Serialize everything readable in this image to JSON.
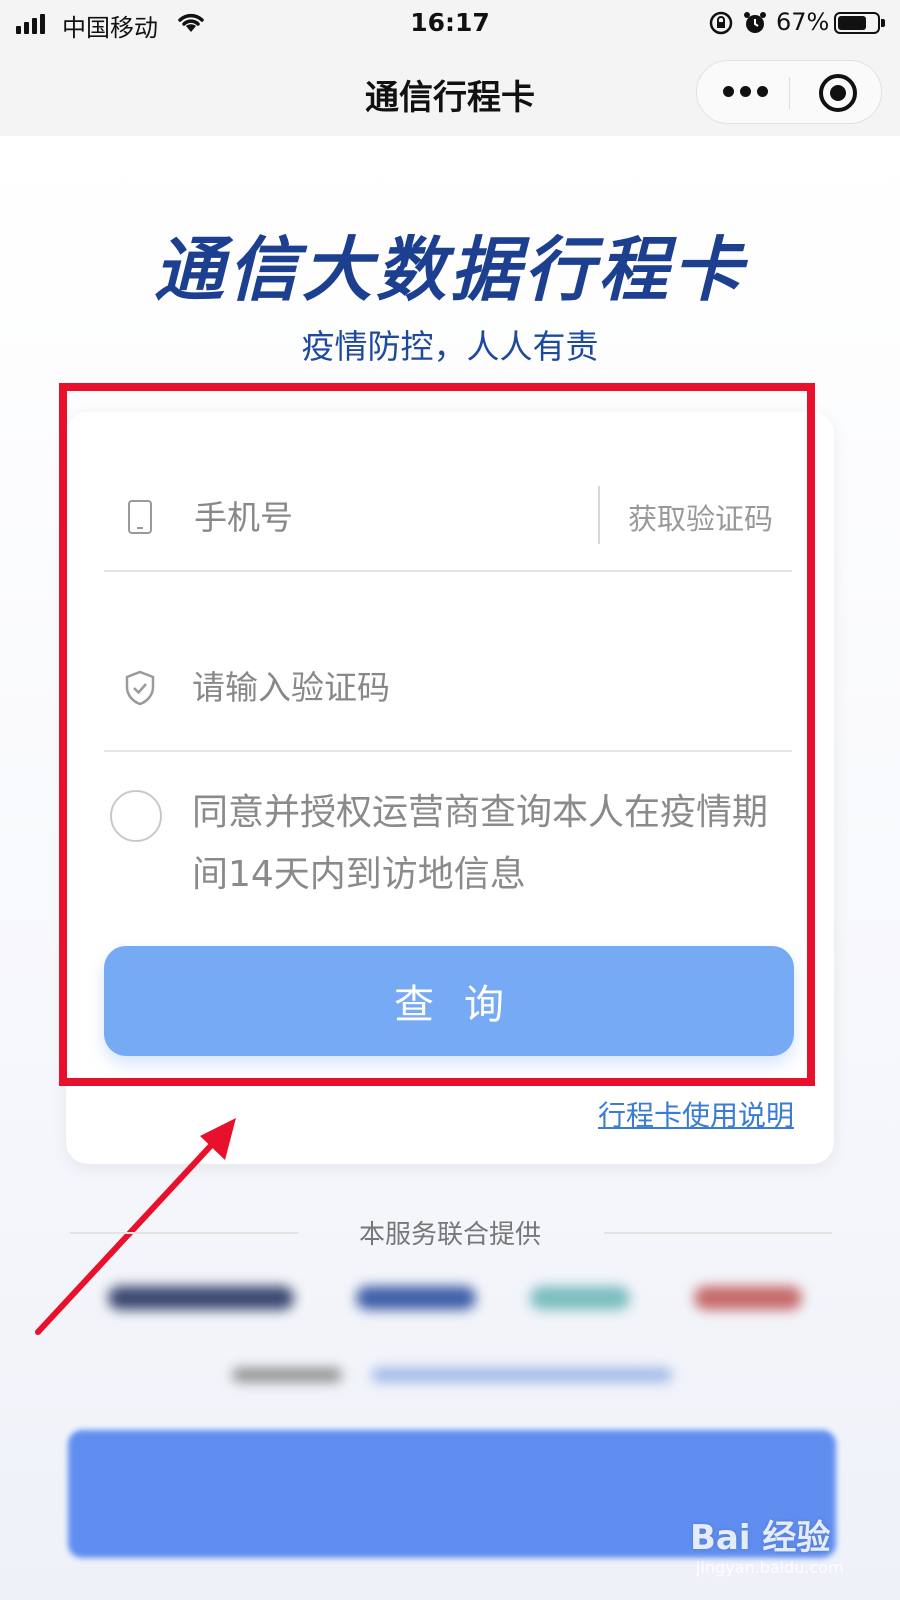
{
  "status_bar": {
    "carrier": "中国移动",
    "time": "16:17",
    "battery_percent": "67%",
    "icons": [
      "signal-icon",
      "wifi-icon",
      "rotation-lock-icon",
      "alarm-icon",
      "battery-icon"
    ]
  },
  "nav": {
    "title": "通信行程卡",
    "icons": [
      "more-icon",
      "close-miniprogram-icon"
    ]
  },
  "hero": {
    "title": "通信大数据行程卡",
    "subtitle": "疫情防控，人人有责"
  },
  "form": {
    "phone_placeholder": "手机号",
    "get_code_label": "获取验证码",
    "code_placeholder": "请输入验证码",
    "consent_text": "同意并授权运营商查询本人在疫情期间14天内到访地信息",
    "consent_checked": false,
    "query_label": "查询",
    "usage_link": "行程卡使用说明"
  },
  "footer": {
    "provider_label": "本服务联合提供"
  },
  "watermark": {
    "brand": "Bai 经验",
    "url": "jingyan.baidu.com"
  },
  "colors": {
    "title_blue": "#1c3f8f",
    "button_blue": "#76aaf5",
    "link_blue": "#3a7bd5",
    "annotation_red": "#e8102a"
  }
}
